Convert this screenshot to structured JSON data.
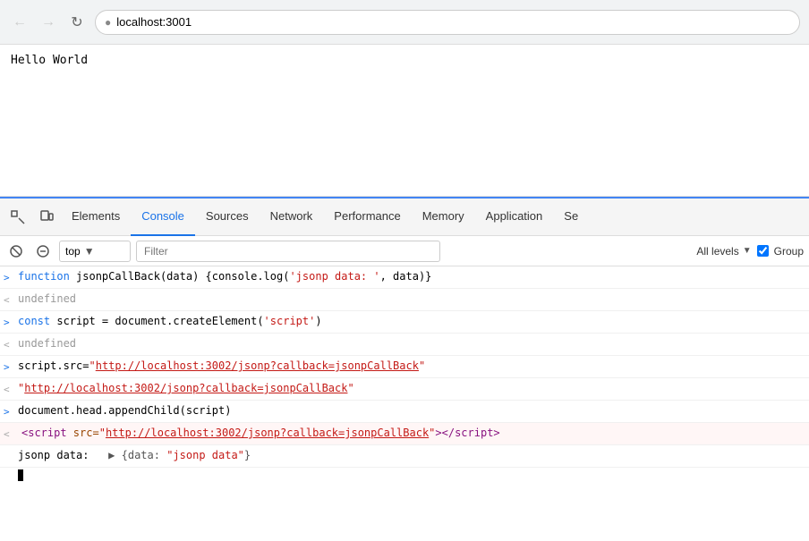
{
  "browser": {
    "url": "localhost:3001",
    "back_btn": "←",
    "forward_btn": "→",
    "reload_btn": "↻"
  },
  "page": {
    "content": "Hello World"
  },
  "devtools": {
    "tabs": [
      {
        "label": "Elements",
        "active": false
      },
      {
        "label": "Console",
        "active": true
      },
      {
        "label": "Sources",
        "active": false
      },
      {
        "label": "Network",
        "active": false
      },
      {
        "label": "Performance",
        "active": false
      },
      {
        "label": "Memory",
        "active": false
      },
      {
        "label": "Application",
        "active": false
      },
      {
        "label": "Se",
        "active": false
      }
    ],
    "toolbar": {
      "context": "top",
      "filter_placeholder": "Filter",
      "levels_label": "All levels",
      "group_label": "Group"
    },
    "console_lines": [
      {
        "type": "input",
        "arrow": ">",
        "content": "function jsonpCallBack(data) {console.log('jsonp data: ', data)}"
      },
      {
        "type": "output",
        "arrow": "<",
        "content": "undefined"
      },
      {
        "type": "input",
        "arrow": ">",
        "content_parts": [
          {
            "text": "const script = document.createElement(",
            "color": "purple"
          },
          {
            "text": "'script'",
            "color": "red"
          },
          {
            "text": ")",
            "color": "purple"
          }
        ]
      },
      {
        "type": "output",
        "arrow": "<",
        "content": "undefined"
      },
      {
        "type": "input",
        "arrow": ">",
        "content_key": "script_src_set"
      },
      {
        "type": "output",
        "arrow": "<",
        "content_key": "script_src_link"
      },
      {
        "type": "input",
        "arrow": ">",
        "content": "document.head.appendChild(script)"
      },
      {
        "type": "output",
        "arrow": "<",
        "content_key": "script_tag"
      },
      {
        "type": "log",
        "content_key": "jsonp_data_log"
      }
    ],
    "script_src": "http://localhost:3002/jsonp?callback=jsonpCallBack",
    "jsonp_data_key": "jsonp data",
    "jsonp_data_val": "\"jsonp data\""
  }
}
